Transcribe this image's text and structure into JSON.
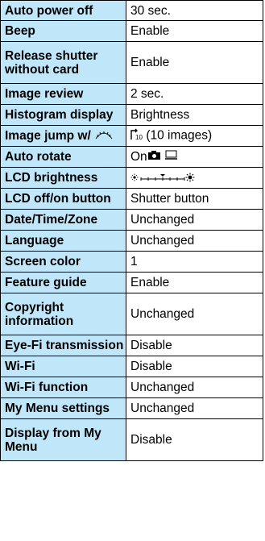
{
  "colors": {
    "label_bg": "#bfe6f9",
    "value_bg": "#ffffff",
    "border": "#000000"
  },
  "rows": [
    {
      "label": "Auto power off",
      "value": "30 sec."
    },
    {
      "label": "Beep",
      "value": "Enable"
    },
    {
      "label": "Release shutter without card",
      "value": "Enable"
    },
    {
      "label": "Image review",
      "value": "2 sec."
    },
    {
      "label": "Histogram display",
      "value": "Brightness"
    },
    {
      "label": "Image jump w/",
      "label_icon": "main-dial-icon",
      "value_icon": "jump-10-images-icon",
      "value": "(10 images)"
    },
    {
      "label": "Auto rotate",
      "value": "On",
      "value_icons": [
        "camera-icon",
        "computer-monitor-icon"
      ]
    },
    {
      "label": "LCD brightness",
      "value_icon": "brightness-scale-icon",
      "brightness_level": 4
    },
    {
      "label": "LCD off/on button",
      "value": "Shutter button"
    },
    {
      "label": "Date/Time/Zone",
      "value": "Unchanged"
    },
    {
      "label": "Language",
      "value": "Unchanged"
    },
    {
      "label": "Screen color",
      "value": "1"
    },
    {
      "label": "Feature guide",
      "value": "Enable"
    },
    {
      "label": "Copyright information",
      "value": "Unchanged"
    },
    {
      "label": "Eye-Fi transmission",
      "value": "Disable"
    },
    {
      "label": "Wi-Fi",
      "value": "Disable"
    },
    {
      "label": "Wi-Fi function",
      "value": "Unchanged"
    },
    {
      "label": "My Menu settings",
      "value": "Unchanged"
    },
    {
      "label": "Display from My Menu",
      "value": "Disable"
    }
  ]
}
